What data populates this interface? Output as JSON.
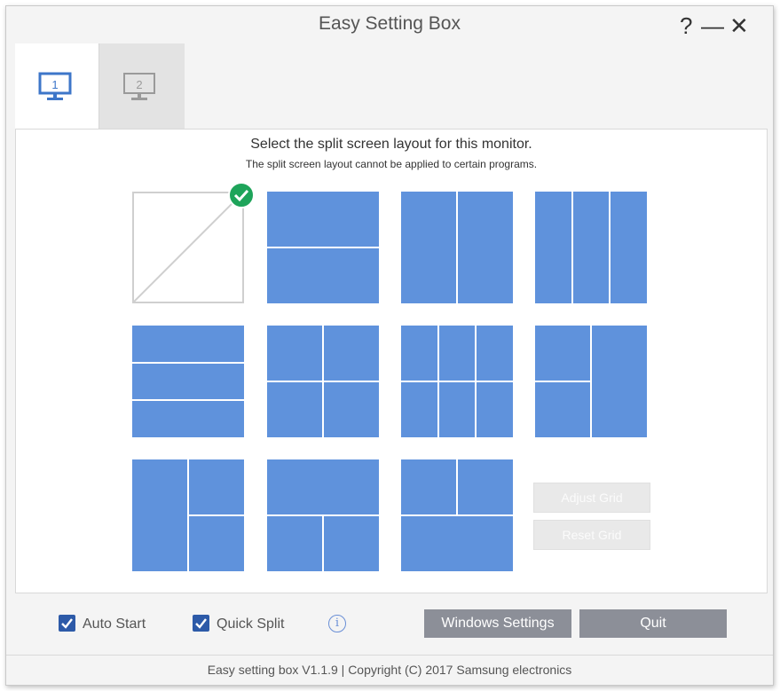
{
  "window": {
    "title": "Easy Setting Box",
    "help_label": "?",
    "minimize_label": "—",
    "close_label": "✕"
  },
  "tabs": [
    {
      "label": "1",
      "icon": "monitor-icon",
      "selected": true
    },
    {
      "label": "2",
      "icon": "monitor-icon",
      "selected": false
    }
  ],
  "main": {
    "heading": "Select the split screen layout for this monitor.",
    "subheading": "The split screen layout cannot be applied to certain programs.",
    "layouts": [
      {
        "name": "none",
        "selected": true
      },
      {
        "name": "2-horizontal"
      },
      {
        "name": "2-vertical"
      },
      {
        "name": "3-vertical"
      },
      {
        "name": "3-horizontal"
      },
      {
        "name": "4-grid"
      },
      {
        "name": "6-grid"
      },
      {
        "name": "left-split-right-full"
      },
      {
        "name": "left-full-right-split"
      },
      {
        "name": "top-full-bottom-split"
      },
      {
        "name": "top-split-bottom-full"
      }
    ],
    "adjust_grid_label": "Adjust Grid",
    "reset_grid_label": "Reset Grid"
  },
  "footer": {
    "auto_start_label": "Auto Start",
    "auto_start_checked": true,
    "quick_split_label": "Quick Split",
    "quick_split_checked": true,
    "info_label": "i",
    "windows_settings_label": "Windows Settings",
    "quit_label": "Quit",
    "copyright": "Easy setting box V1.1.9 | Copyright (C) 2017 Samsung electronics"
  },
  "colors": {
    "pane": "#5f92dc",
    "checkbox": "#2d5aa8",
    "selected_check": "#1ea45a",
    "button": "#8c8f98"
  }
}
